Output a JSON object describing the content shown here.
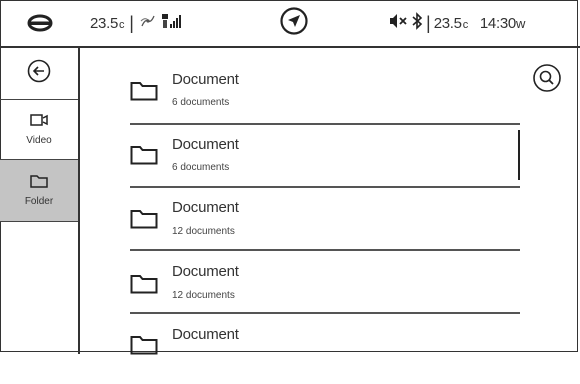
{
  "status_bar": {
    "outside_temp": "23.5",
    "outside_temp_unit": "c",
    "inside_temp": "23.5",
    "inside_temp_unit": "c",
    "time": "14:30",
    "time_suffix": "w",
    "icons": [
      "car-icon",
      "fan-icon",
      "signal-icon",
      "navigation-icon",
      "mute-icon",
      "bluetooth-icon"
    ]
  },
  "sidebar": {
    "back_icon": "back-arrow-icon",
    "items": [
      {
        "label": "Video",
        "icon": "video-camera-icon",
        "selected": false
      },
      {
        "label": "Folder",
        "icon": "folder-icon",
        "selected": true
      }
    ]
  },
  "list": {
    "search_icon": "search-icon",
    "items": [
      {
        "title": "Document",
        "subtitle": "6 documents"
      },
      {
        "title": "Document",
        "subtitle": "6 documents"
      },
      {
        "title": "Document",
        "subtitle": "12 documents"
      },
      {
        "title": "Document",
        "subtitle": "12 documents"
      },
      {
        "title": "Document",
        "subtitle": ""
      }
    ]
  },
  "colors": {
    "selected_background": "#c4c4c4",
    "line": "#333333"
  }
}
